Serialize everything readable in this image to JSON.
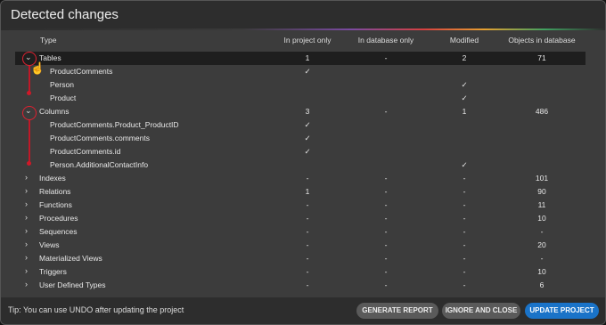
{
  "dialog": {
    "title": "Detected changes"
  },
  "columns": {
    "type": "Type",
    "in_project_only": "In project only",
    "in_database_only": "In database only",
    "modified": "Modified",
    "objects_in_database": "Objects in database"
  },
  "rows": [
    {
      "label": "Tables",
      "kind": "group",
      "expanded": true,
      "project": "1",
      "database": "-",
      "modified": "2",
      "objects": "71"
    },
    {
      "label": "ProductComments",
      "kind": "child",
      "project": "✓",
      "database": "",
      "modified": "",
      "objects": ""
    },
    {
      "label": "Person",
      "kind": "child",
      "project": "",
      "database": "",
      "modified": "✓",
      "objects": ""
    },
    {
      "label": "Product",
      "kind": "child",
      "project": "",
      "database": "",
      "modified": "✓",
      "objects": ""
    },
    {
      "label": "Columns",
      "kind": "group",
      "expanded": true,
      "project": "3",
      "database": "-",
      "modified": "1",
      "objects": "486"
    },
    {
      "label": "ProductComments.Product_ProductID",
      "kind": "child",
      "project": "✓",
      "database": "",
      "modified": "",
      "objects": ""
    },
    {
      "label": "ProductComments.comments",
      "kind": "child",
      "project": "✓",
      "database": "",
      "modified": "",
      "objects": ""
    },
    {
      "label": "ProductComments.id",
      "kind": "child",
      "project": "✓",
      "database": "",
      "modified": "",
      "objects": ""
    },
    {
      "label": "Person.AdditionalContactInfo",
      "kind": "child",
      "project": "",
      "database": "",
      "modified": "✓",
      "objects": ""
    },
    {
      "label": "Indexes",
      "kind": "group",
      "expanded": false,
      "project": "-",
      "database": "-",
      "modified": "-",
      "objects": "101"
    },
    {
      "label": "Relations",
      "kind": "group",
      "expanded": false,
      "project": "1",
      "database": "-",
      "modified": "-",
      "objects": "90"
    },
    {
      "label": "Functions",
      "kind": "group",
      "expanded": false,
      "project": "-",
      "database": "-",
      "modified": "-",
      "objects": "11"
    },
    {
      "label": "Procedures",
      "kind": "group",
      "expanded": false,
      "project": "-",
      "database": "-",
      "modified": "-",
      "objects": "10"
    },
    {
      "label": "Sequences",
      "kind": "group",
      "expanded": false,
      "project": "-",
      "database": "-",
      "modified": "-",
      "objects": "-"
    },
    {
      "label": "Views",
      "kind": "group",
      "expanded": false,
      "project": "-",
      "database": "-",
      "modified": "-",
      "objects": "20"
    },
    {
      "label": "Materialized Views",
      "kind": "group",
      "expanded": false,
      "project": "-",
      "database": "-",
      "modified": "-",
      "objects": "-"
    },
    {
      "label": "Triggers",
      "kind": "group",
      "expanded": false,
      "project": "-",
      "database": "-",
      "modified": "-",
      "objects": "10"
    },
    {
      "label": "User Defined Types",
      "kind": "group",
      "expanded": false,
      "project": "-",
      "database": "-",
      "modified": "-",
      "objects": "6"
    }
  ],
  "footer": {
    "tip": "Tip: You can use UNDO after updating the project",
    "generate_report": "GENERATE REPORT",
    "ignore_and_close": "IGNORE AND CLOSE",
    "update_project": "UPDATE PROJECT"
  },
  "colors": {
    "accent_red": "#e02030",
    "primary_button": "#1a73c8"
  }
}
